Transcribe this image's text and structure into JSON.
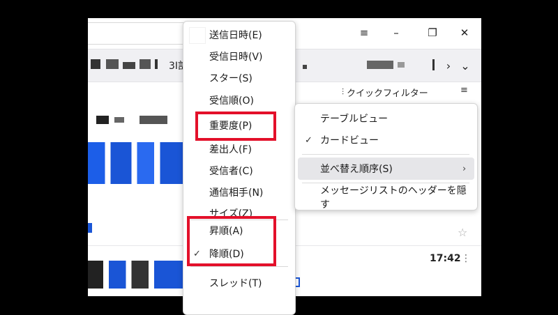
{
  "window": {
    "controls": {
      "menu": "≡",
      "minimize": "–",
      "maximize": "❐",
      "close": "✕"
    }
  },
  "toolbar": {
    "partial_text": "3I訁",
    "scroll_right": "›",
    "scroll_down": "⌄"
  },
  "message_list": {
    "quick_filter_label": "クイックフィルター",
    "email_card_time": "17:42"
  },
  "sort_menu": {
    "items": [
      {
        "label": "送信日時(E)"
      },
      {
        "label": "受信日時(V)"
      },
      {
        "label": "スター(S)"
      },
      {
        "label": "受信順(O)"
      },
      {
        "label": "重要度(P)"
      },
      {
        "label": "差出人(F)"
      },
      {
        "label": "受信者(C)"
      },
      {
        "label": "通信相手(N)"
      },
      {
        "label": "サイズ(Z)"
      }
    ],
    "order_items": [
      {
        "label": "昇順(A)",
        "checked": false
      },
      {
        "label": "降順(D)",
        "checked": true
      }
    ],
    "thread_item": {
      "label": "スレッド(T)"
    }
  },
  "context_menu": {
    "items": [
      {
        "label": "テーブルビュー",
        "checked": false
      },
      {
        "label": "カードビュー",
        "checked": true
      },
      {
        "label": "並べ替え順序(S)",
        "submenu": true,
        "highlighted": true
      },
      {
        "label": "メッセージリストのヘッダーを隠す"
      }
    ],
    "check_glyph": "✓",
    "arrow_glyph": "›"
  },
  "colors": {
    "highlight_red": "#e3102a",
    "link_blue": "#1a55d6",
    "hover_gray": "#e6e6e9"
  }
}
